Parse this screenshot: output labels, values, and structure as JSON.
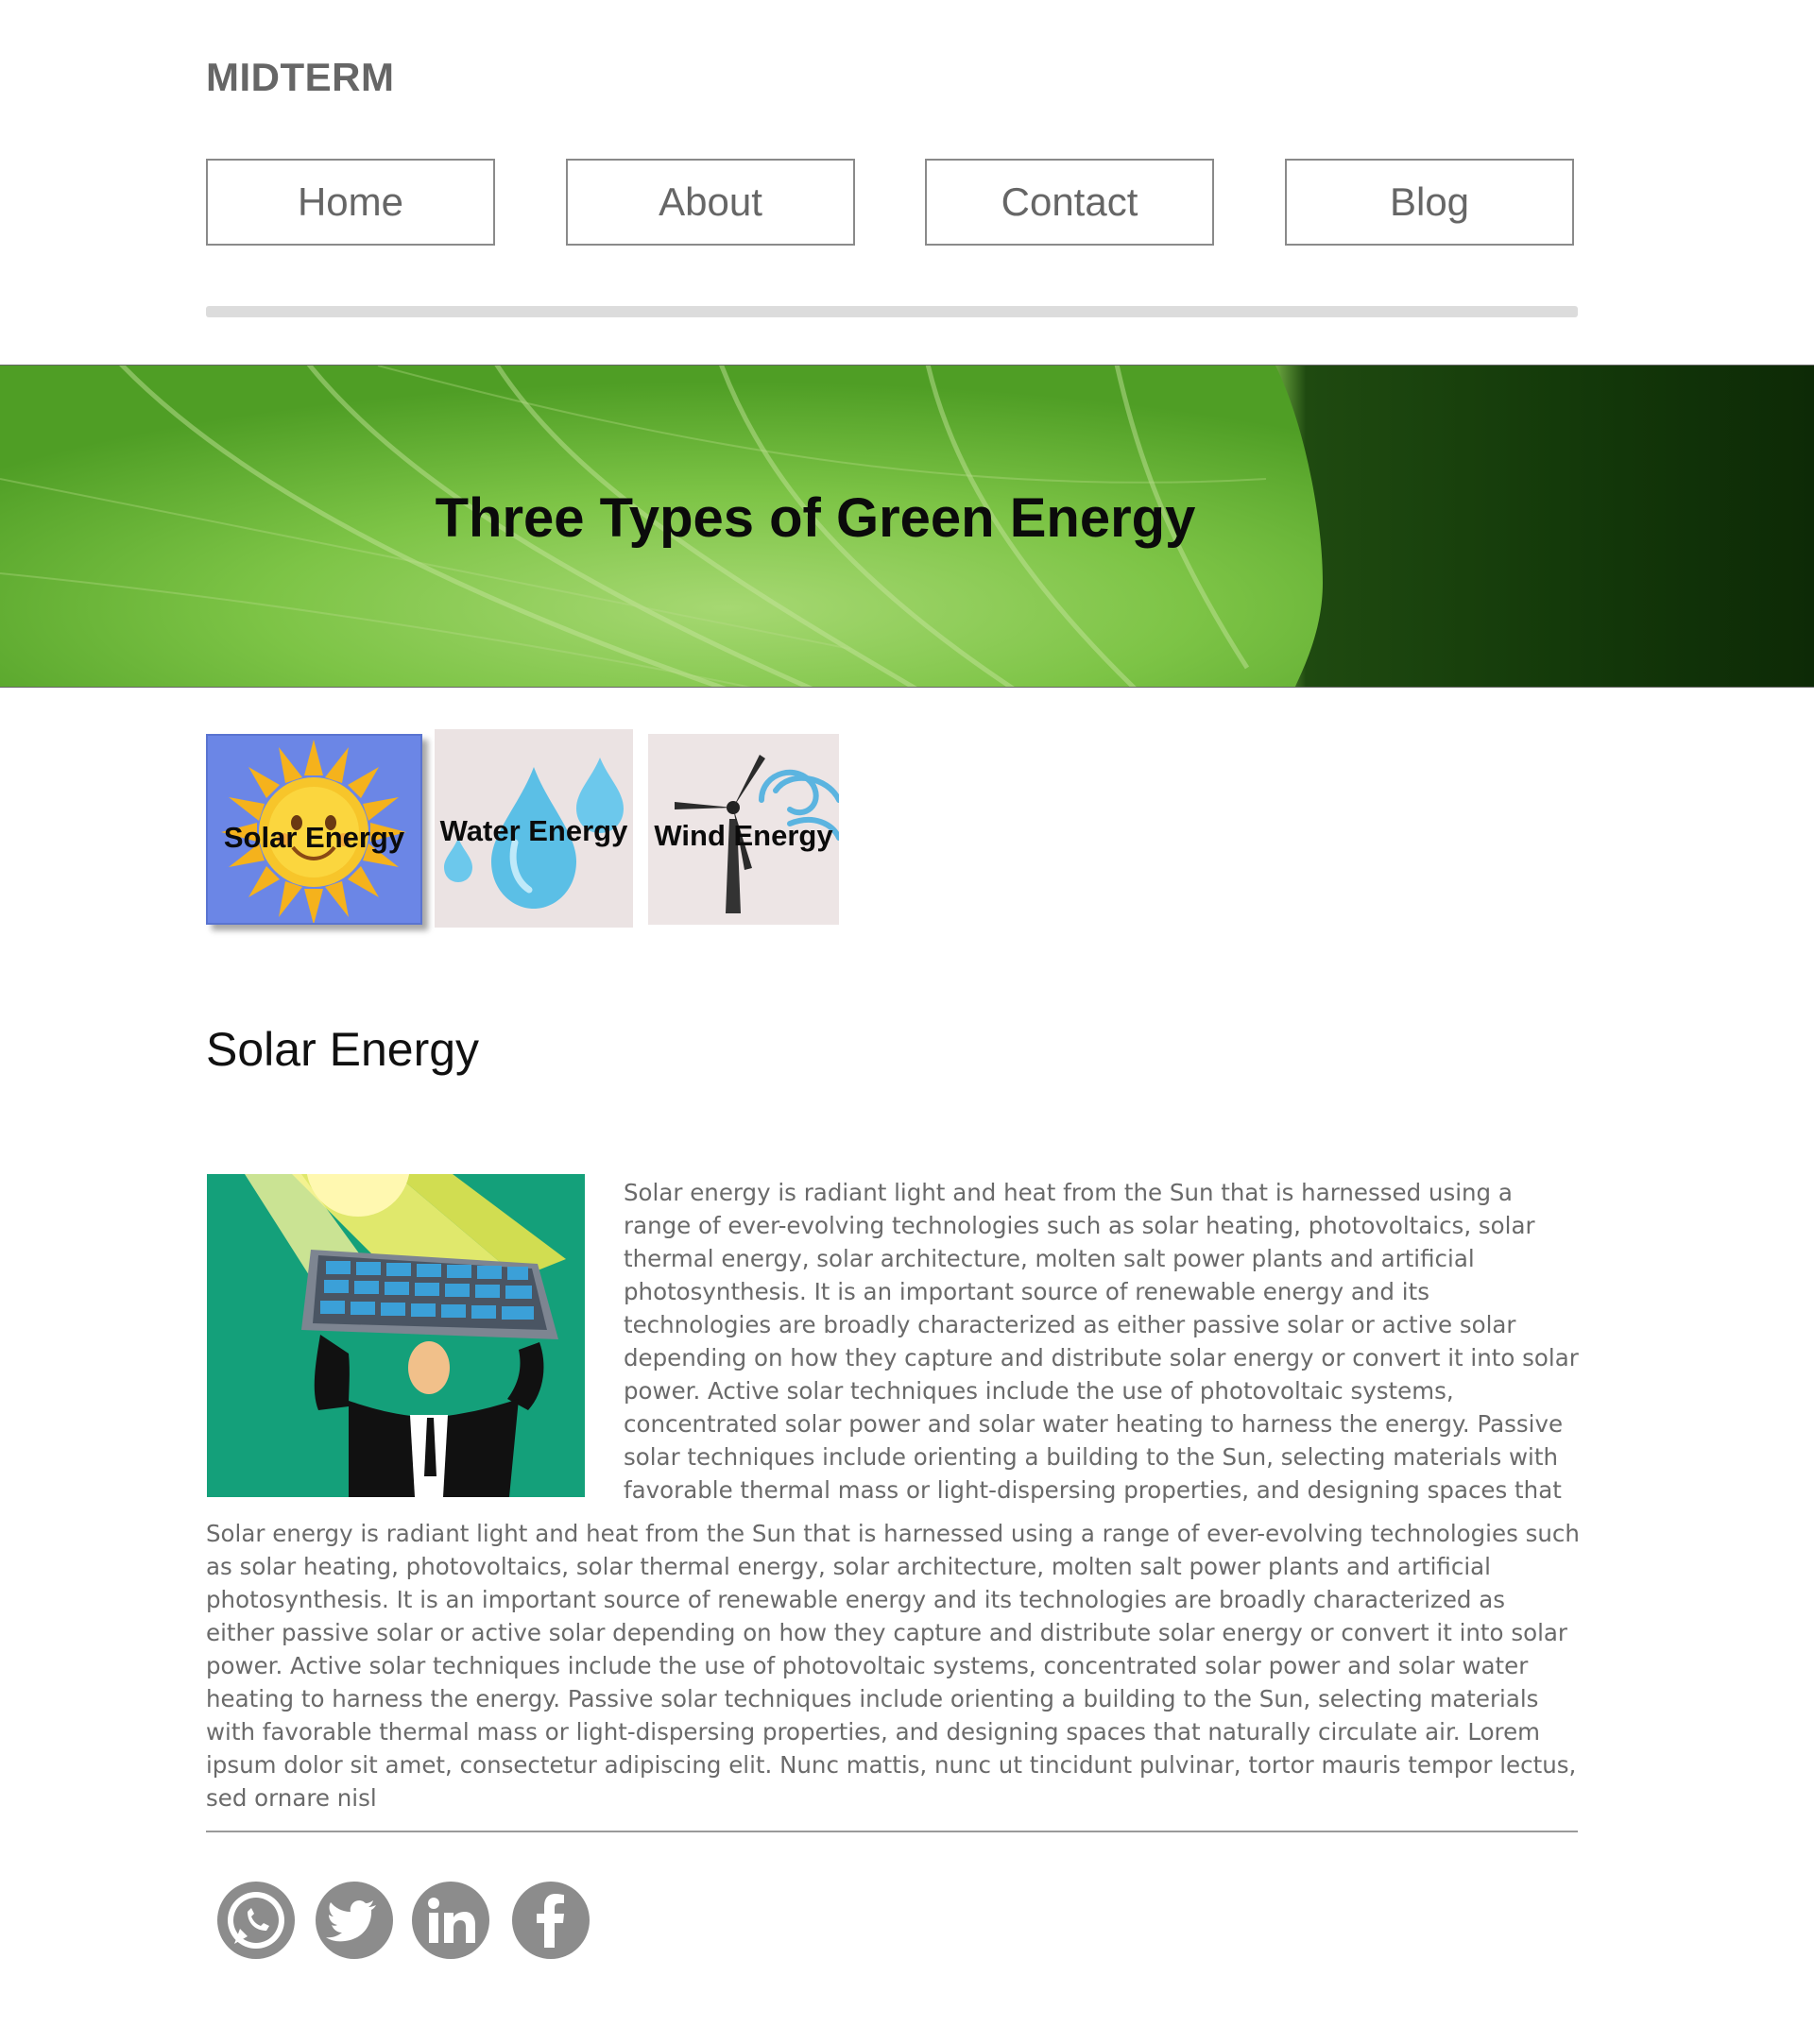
{
  "site": {
    "title": "MIDTERM"
  },
  "nav": {
    "items": [
      {
        "label": "Home"
      },
      {
        "label": "About"
      },
      {
        "label": "Contact"
      },
      {
        "label": "Blog"
      }
    ]
  },
  "hero": {
    "title": "Three Types of Green Energy"
  },
  "tiles": [
    {
      "label": "Solar Energy"
    },
    {
      "label": "Water Energy"
    },
    {
      "label": "Wind Energy"
    }
  ],
  "article": {
    "heading": "Solar Energy",
    "paragraph_1": "Solar energy is radiant light and heat from the Sun that is harnessed using a range of ever-evolving technologies such as solar heating, photovoltaics, solar thermal energy, solar architecture, molten salt power plants and artificial photosynthesis. It is an important source of renewable energy and its technologies are broadly characterized as either passive solar or active solar depending on how they capture and distribute solar energy or convert it into solar power. Active solar techniques include the use of photovoltaic systems, concentrated solar power and solar water heating to harness the energy. Passive solar techniques include orienting a building to the Sun, selecting materials with favorable thermal mass or light-dispersing properties, and designing spaces that naturally circulate air. Lorem ipsum dolor sit amet, consectetur adipiscing",
    "paragraph_2": "Solar energy is radiant light and heat from the Sun that is harnessed using a range of ever-evolving technologies such as solar heating, photovoltaics, solar thermal energy, solar architecture, molten salt power plants and artificial photosynthesis. It is an important source of renewable energy and its technologies are broadly characterized as either passive solar or active solar depending on how they capture and distribute solar energy or convert it into solar power. Active solar techniques include the use of photovoltaic systems, concentrated solar power and solar water heating to harness the energy. Passive solar techniques include orienting a building to the Sun, selecting materials with favorable thermal mass or light-dispersing properties, and designing spaces that naturally circulate air. Lorem ipsum dolor sit amet, consectetur adipiscing elit. Nunc mattis, nunc ut tincidunt pulvinar, tortor mauris tempor lectus, sed ornare nisl"
  },
  "social": {
    "icons": [
      "whatsapp-icon",
      "twitter-icon",
      "linkedin-icon",
      "facebook-icon"
    ]
  },
  "colors": {
    "nav_text": "#666666",
    "body_text": "#6a6a6a",
    "social_icon": "#8c8c8c",
    "solar_tile_bg": "#6b86e6",
    "article_image_bg": "#14a07a"
  }
}
